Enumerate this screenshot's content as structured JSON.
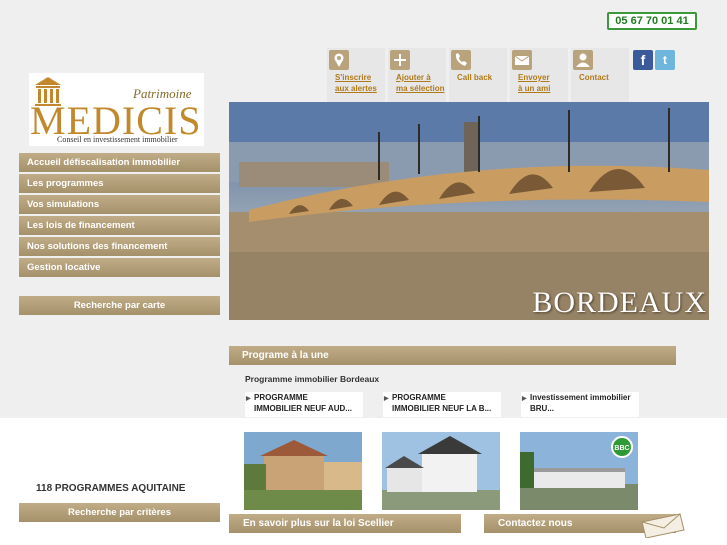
{
  "header": {
    "phone": "05 67 70 01 41",
    "nav": [
      {
        "label": "S'inscrire\naux alertes",
        "icon": "map-pin-icon",
        "underline": true
      },
      {
        "label": "Ajouter à\nma sélection",
        "icon": "plus-icon",
        "underline": true
      },
      {
        "label": "Call back",
        "icon": "phone-icon",
        "underline": false
      },
      {
        "label": "Envoyer\nà un ami",
        "icon": "mail-icon",
        "underline": true
      },
      {
        "label": "Contact",
        "icon": "person-icon",
        "underline": false
      }
    ],
    "social": {
      "facebook": "f",
      "twitter": "t"
    }
  },
  "logo": {
    "script": "Patrimoine",
    "name": "MEDICIS",
    "tagline": "Conseil en investissement immobilier"
  },
  "sidebar": {
    "menu": [
      "Accueil défiscalisation immobilier",
      "Les programmes",
      "Vos simulations",
      "Les lois de financement",
      "Nos solutions des financement",
      "Gestion locative"
    ],
    "map_search": "Recherche par carte",
    "program_count": "118 PROGRAMMES AQUITAINE",
    "criteria_search": "Recherche par critères"
  },
  "hero": {
    "caption": "BORDEAUX"
  },
  "featured": {
    "section_title": "Programe à la une",
    "subtitle": "Programme immobilier Bordeaux",
    "programs": [
      {
        "title": "PROGRAMME\nIMMOBILIER NEUF AUD..."
      },
      {
        "title": "PROGRAMME\nIMMOBILIER NEUF LA B..."
      },
      {
        "title": "Investissement immobilier\nBRU..."
      }
    ],
    "badge": "BBC"
  },
  "footer": {
    "scellier": "En savoir plus sur la loi Scellier",
    "contact": "Contactez nous"
  },
  "colors": {
    "accent_gold": "#b07a1a",
    "menu_bar": "#a4916a",
    "phone_border": "#3a9a3a",
    "background": "#efefef"
  }
}
